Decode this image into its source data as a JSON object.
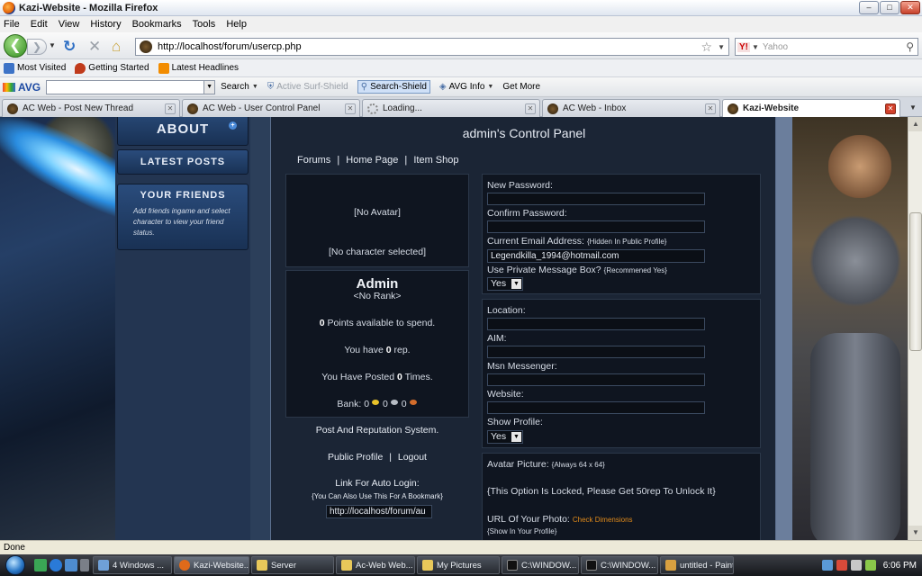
{
  "window": {
    "title": "Kazi-Website - Mozilla Firefox",
    "minimize": "–",
    "maximize": "□",
    "close": "✕"
  },
  "menu": [
    "File",
    "Edit",
    "View",
    "History",
    "Bookmarks",
    "Tools",
    "Help"
  ],
  "nav": {
    "url": "http://localhost/forum/usercp.php",
    "search_placeholder": "Yahoo",
    "search_engine_logo": "Y!",
    "back": "❮",
    "forward": "❯"
  },
  "bookmarks": [
    "Most Visited",
    "Getting Started",
    "Latest Headlines"
  ],
  "avg": {
    "logo": "AVG",
    "items": [
      "Search",
      "Active Surf-Shield",
      "Search-Shield",
      "AVG Info",
      "Get More"
    ]
  },
  "tabs": [
    {
      "label": "AC Web - Post New Thread"
    },
    {
      "label": "AC Web - User Control Panel"
    },
    {
      "label": "Loading..."
    },
    {
      "label": "AC Web - Inbox"
    },
    {
      "label": "Kazi-Website"
    }
  ],
  "sidebar": {
    "about": "ABOUT",
    "latest_posts": "LATEST POSTS",
    "your_friends": "YOUR FRIENDS",
    "friends_text": "Add friends ingame and select character to view your friend status."
  },
  "panel": {
    "title": "admin's Control Panel",
    "nav": [
      "Forums",
      "Home Page",
      "Item Shop"
    ],
    "nav_sep": "|",
    "no_avatar": "[No Avatar]",
    "no_character": "[No character selected]",
    "name": "Admin",
    "rank": "<No Rank>",
    "points_value": "0",
    "points_text": "Points available to spend.",
    "rep_prefix": "You have",
    "rep_value": "0",
    "rep_suffix": "rep.",
    "posted_prefix": "You Have Posted",
    "posted_value": "0",
    "posted_suffix": "Times.",
    "bank_label": "Bank:",
    "bank_gold": "0",
    "bank_silver": "0",
    "bank_copper": "0",
    "rep_system": "Post And Reputation System.",
    "public_profile": "Public Profile",
    "logout": "Logout",
    "autologin_label": "Link For Auto Login:",
    "autologin_note": "{You Can Also Use This For A Bookmark}",
    "autologin_value": "http://localhost/forum/au"
  },
  "form": {
    "new_password": "New Password:",
    "confirm_password": "Confirm Password:",
    "email_label": "Current Email Address:",
    "email_note": "{Hidden In Public Profile}",
    "email_value": "Legendkilla_1994@hotmail.com",
    "pm_label": "Use Private Message Box?",
    "pm_note": "{Recommened Yes}",
    "pm_value": "Yes",
    "location": "Location:",
    "aim": "AIM:",
    "msn": "Msn Messenger:",
    "website": "Website:",
    "show_profile": "Show Profile:",
    "show_profile_value": "Yes",
    "avatar_label": "Avatar Picture:",
    "avatar_note": "{Always 64 x 64}",
    "locked_msg": "{This Option Is Locked, Please Get 50rep To Unlock It}",
    "photo_url_label": "URL Of Your Photo:",
    "check_dimensions": "Check Dimensions",
    "show_in_profile": "{Show In Your Profile}"
  },
  "status": "Done",
  "taskbar": {
    "buttons": [
      "4 Windows ...",
      "Kazi-Website...",
      "Server",
      "Ac-Web Web...",
      "My Pictures",
      "C:\\WINDOW...",
      "C:\\WINDOW...",
      "untitled - Paint"
    ],
    "clock": "6:06 PM"
  }
}
